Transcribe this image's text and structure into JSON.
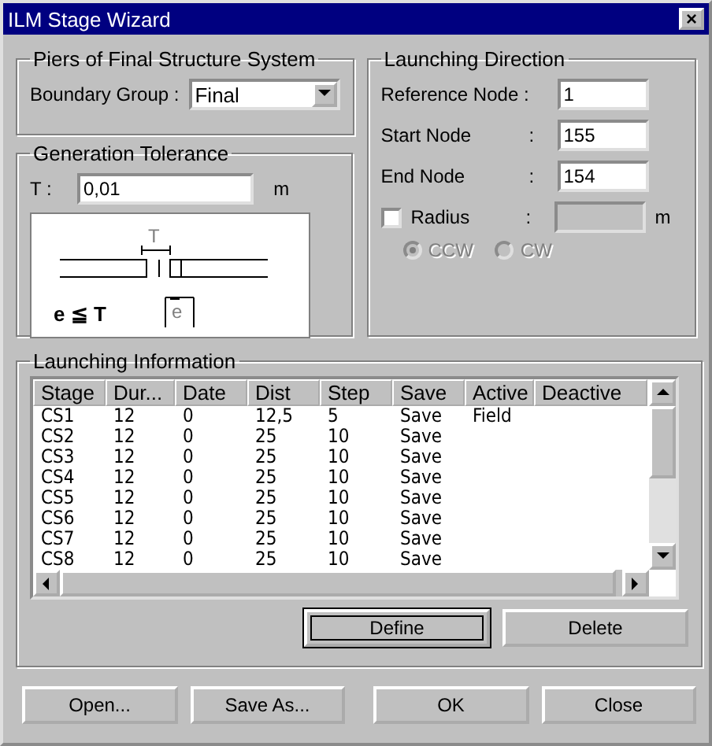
{
  "window": {
    "title": "ILM Stage Wizard",
    "close": "×"
  },
  "piers": {
    "title": "Piers of Final Structure System",
    "label": "Boundary Group :",
    "value": "Final"
  },
  "tolerance": {
    "title": "Generation Tolerance",
    "label": "T :",
    "value": "0,01",
    "unit": "m",
    "diagram": {
      "gap_label": "T",
      "offset_label": "e",
      "formula": "e ≦ T"
    }
  },
  "direction": {
    "title": "Launching Direction",
    "fields": [
      {
        "label": "Reference Node :",
        "value": "1"
      },
      {
        "label": "Start Node",
        "colon": ":",
        "value": "155"
      },
      {
        "label": "End Node",
        "colon": ":",
        "value": "154"
      }
    ],
    "radius": {
      "label": "Radius",
      "colon": ":",
      "checked": false,
      "unit": "m"
    },
    "options": [
      {
        "label": "CCW",
        "selected": true,
        "disabled": true
      },
      {
        "label": "CW",
        "selected": false,
        "disabled": true
      }
    ]
  },
  "launching": {
    "title": "Launching Information",
    "columns": [
      "Stage",
      "Dur...",
      "Date",
      "Dist",
      "Step",
      "Save",
      "Active",
      "Deactive"
    ],
    "rows": [
      [
        "CS1",
        "12",
        "0",
        "12,5",
        "5",
        "Save",
        "Field",
        ""
      ],
      [
        "CS2",
        "12",
        "0",
        "25",
        "10",
        "Save",
        "",
        ""
      ],
      [
        "CS3",
        "12",
        "0",
        "25",
        "10",
        "Save",
        "",
        ""
      ],
      [
        "CS4",
        "12",
        "0",
        "25",
        "10",
        "Save",
        "",
        ""
      ],
      [
        "CS5",
        "12",
        "0",
        "25",
        "10",
        "Save",
        "",
        ""
      ],
      [
        "CS6",
        "12",
        "0",
        "25",
        "10",
        "Save",
        "",
        ""
      ],
      [
        "CS7",
        "12",
        "0",
        "25",
        "10",
        "Save",
        "",
        ""
      ],
      [
        "CS8",
        "12",
        "0",
        "25",
        "10",
        "Save",
        "",
        ""
      ]
    ],
    "buttons": [
      {
        "label": "Define",
        "focused": true
      },
      {
        "label": "Delete",
        "focused": false
      }
    ]
  },
  "footer": [
    "Open...",
    "Save As...",
    "OK",
    "Close"
  ]
}
